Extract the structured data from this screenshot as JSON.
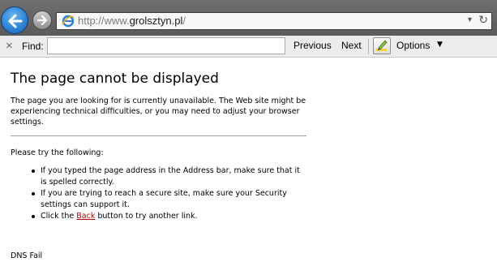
{
  "browser": {
    "url_prefix": "http://www.",
    "url_host": "grolsztyn.pl",
    "url_suffix": "/",
    "back_icon": "back-arrow-icon",
    "forward_icon": "forward-arrow-icon",
    "site_icon": "ie-logo-icon",
    "dropdown_glyph": "▾",
    "refresh_glyph": "↻"
  },
  "findbar": {
    "close_glyph": "×",
    "label": "Find:",
    "input_value": "",
    "previous_label": "Previous",
    "next_label": "Next",
    "options_label": "Options",
    "options_caret": "▼",
    "options_icon": "highlight-pencil-icon"
  },
  "page": {
    "heading": "The page cannot be displayed",
    "intro": "The page you are looking for is currently unavailable. The Web site might be experiencing technical difficulties, or you may need to adjust your browser settings.",
    "try_label": "Please try the following:",
    "tips": [
      "If you typed the page address in the Address bar, make sure that it is spelled correctly.",
      "If you are trying to reach a secure site, make sure your Security settings can support it."
    ],
    "back_tip_before": "Click the ",
    "back_link": "Back",
    "back_tip_after": " button to try another link.",
    "error_code": "DNS Fail"
  },
  "colors": {
    "link": "#c00000",
    "titlebar": "#5e5e5e",
    "back_button": "#2f86d6"
  }
}
